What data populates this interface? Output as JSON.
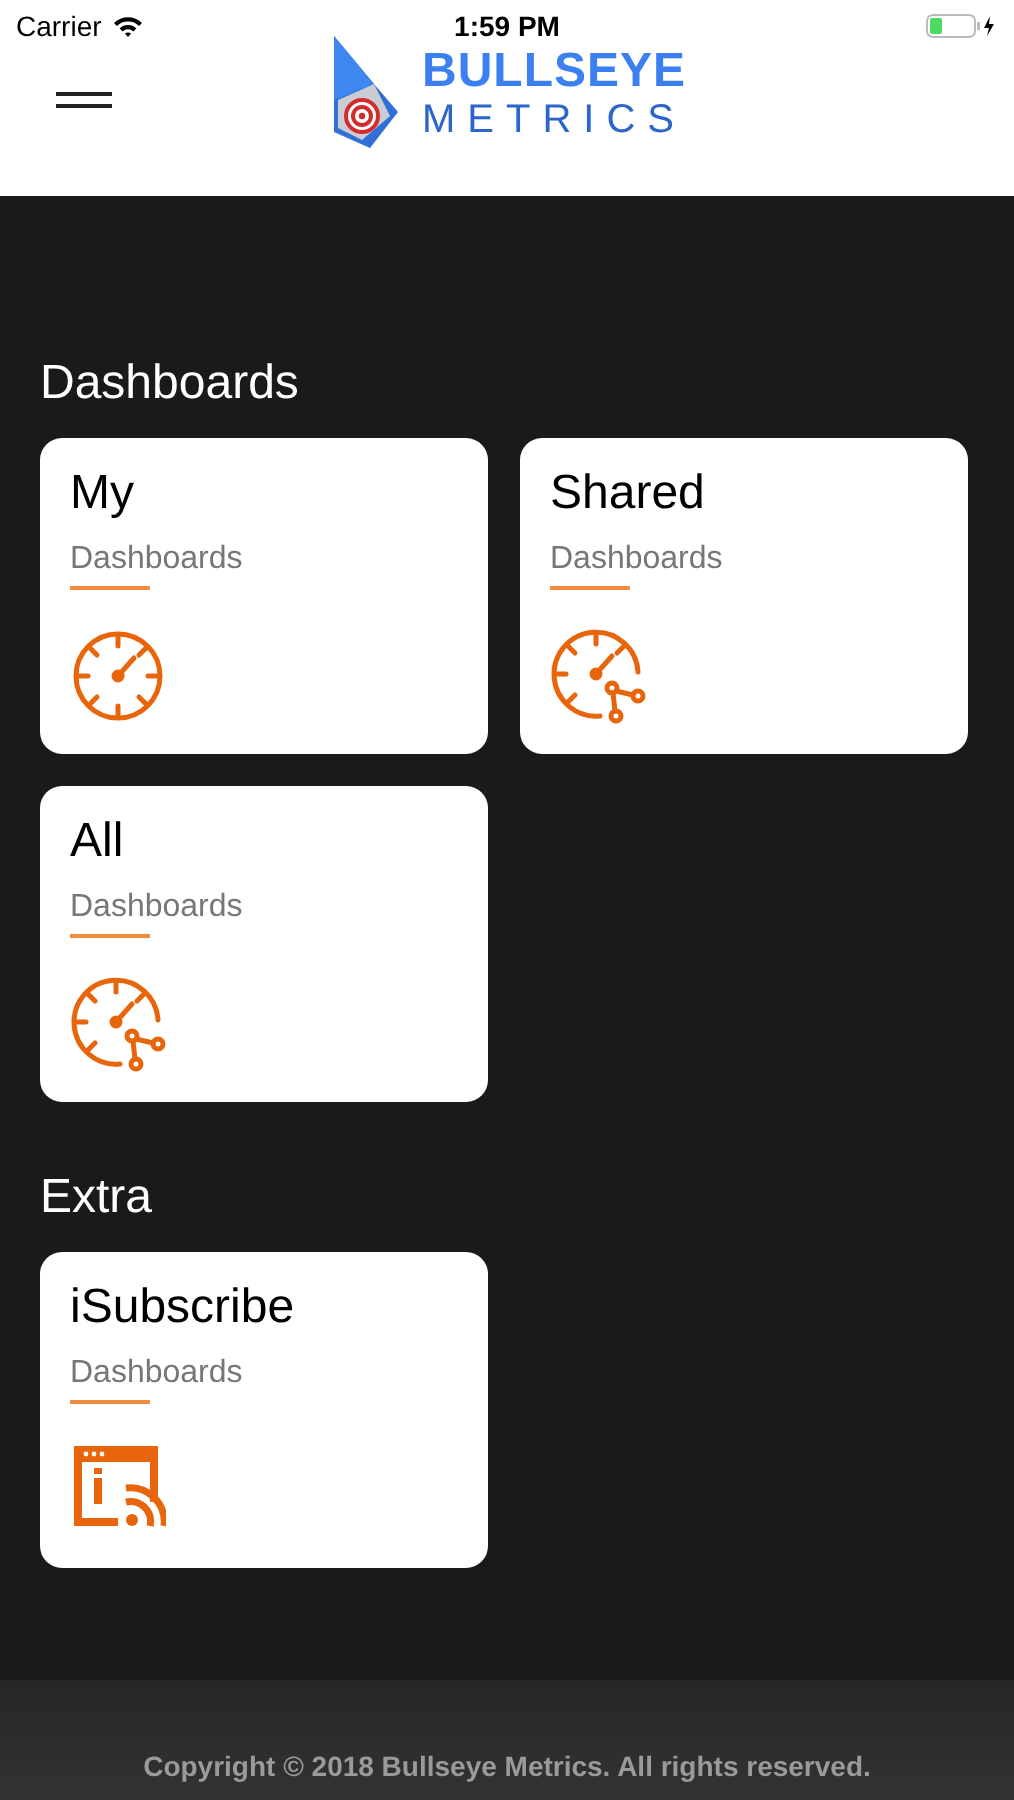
{
  "status_bar": {
    "carrier": "Carrier",
    "time": "1:59 PM"
  },
  "header": {
    "logo_line_1": "BULLSEYE",
    "logo_line_2": "METRICS"
  },
  "sections": [
    {
      "title": "Dashboards",
      "cards": [
        {
          "title": "My",
          "subtitle": "Dashboards",
          "kind": "gauge"
        },
        {
          "title": "Shared",
          "subtitle": "Dashboards",
          "kind": "shared"
        },
        {
          "title": "All",
          "subtitle": "Dashboards",
          "kind": "shared"
        }
      ]
    },
    {
      "title": "Extra",
      "cards": [
        {
          "title": "iSubscribe",
          "subtitle": "Dashboards",
          "kind": "subscribe"
        }
      ]
    }
  ],
  "footer": {
    "text": "Copyright © 2018 Bullseye Metrics. All rights reserved."
  }
}
